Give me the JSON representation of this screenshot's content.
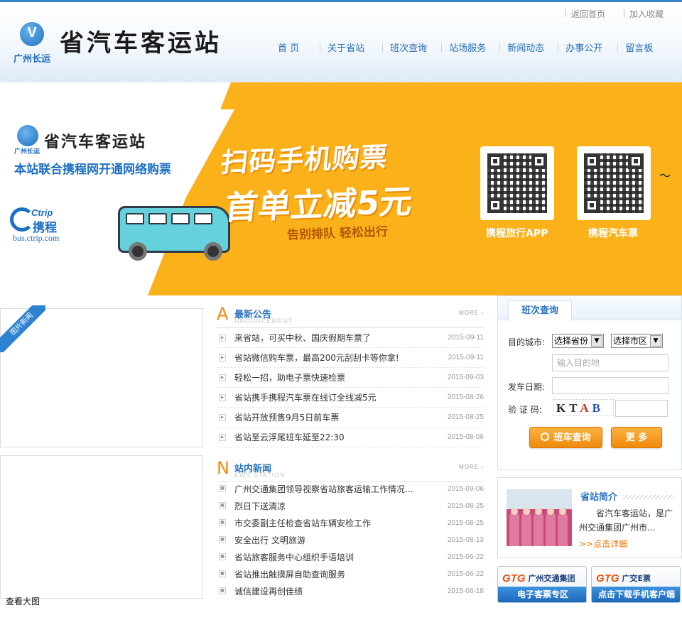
{
  "header": {
    "top_links": [
      "返回首页",
      "加入收藏"
    ],
    "logo_caption": "广州长运",
    "site_title": "省汽车客运站",
    "nav": [
      "首 页",
      "关于省站",
      "班次查询",
      "站场服务",
      "新闻动态",
      "办事公开",
      "留言板"
    ]
  },
  "banner": {
    "logo_caption": "广州长运",
    "title": "省汽车客运站",
    "subtitle": "本站联合携程网开通网络购票",
    "ctrip_en": "Ctrip",
    "ctrip_cn": "携程",
    "ctrip_url": "bus.ctrip.com",
    "slogan_main": "扫码手机购票",
    "slogan_offer": "首单立减5元",
    "slogan_sub": "告别排队  轻松出行",
    "qr_labels": [
      "携程旅行APP",
      "携程汽车票"
    ]
  },
  "photo_news": {
    "ribbon": "图片新闻",
    "view_large": "查看大图"
  },
  "announcements": {
    "initial": "A",
    "title": "最新公告",
    "subtitle": "NNOUNCEMENT",
    "more": "MORE",
    "items": [
      {
        "title": "来省站，可买中秋、国庆假期车票了",
        "date": "2015-09-11"
      },
      {
        "title": "省站微信购车票，最高200元刮刮卡等你拿!",
        "date": "2015-09-11"
      },
      {
        "title": "轻松一招，助电子票快速检票",
        "date": "2015-09-03"
      },
      {
        "title": "省站携手携程汽车票在线订全线减5元",
        "date": "2015-08-26"
      },
      {
        "title": "省站开放预售9月5日前车票",
        "date": "2015-08-25"
      },
      {
        "title": "省站至云浮尾班车延至22:30",
        "date": "2015-08-06"
      }
    ]
  },
  "station_news": {
    "initial": "N",
    "title": "站内新闻",
    "subtitle": "EWS STATION",
    "more": "MORE",
    "items": [
      {
        "title": "广州交通集团领导视察省站旅客运输工作情况...",
        "date": "2015-09-06"
      },
      {
        "title": "烈日下送清凉",
        "date": "2015-08-25"
      },
      {
        "title": "市交委副主任检查省站车辆安检工作",
        "date": "2015-08-25"
      },
      {
        "title": "安全出行  文明旅游",
        "date": "2015-08-13"
      },
      {
        "title": "省站旅客服务中心组织手语培训",
        "date": "2015-06-22"
      },
      {
        "title": "省站推出触摸屏自助查询服务",
        "date": "2015-06-22"
      },
      {
        "title": "诚信建设再创佳绩",
        "date": "2015-06-18"
      }
    ]
  },
  "query": {
    "tab": "班次查询",
    "dest_label": "目的城市:",
    "province_select": "选择省份",
    "district_select": "选择市区",
    "dest_placeholder": "输入目的地",
    "date_label": "发车日期:",
    "captcha_label": "验 证 码:",
    "captcha": [
      "K",
      "T",
      "A",
      "B"
    ],
    "search_button": "班车查询",
    "more_button": "更 多"
  },
  "intro": {
    "title": "省站简介",
    "text": "省汽车客运站，是广州交通集团广州市...",
    "more": ">>点击详细"
  },
  "badges": [
    {
      "mark": "GTG",
      "name": "广州交通集团",
      "bar": "电子客票专区"
    },
    {
      "mark": "GTG",
      "name": "广交E票",
      "bar": "点击下载手机客户端"
    }
  ]
}
